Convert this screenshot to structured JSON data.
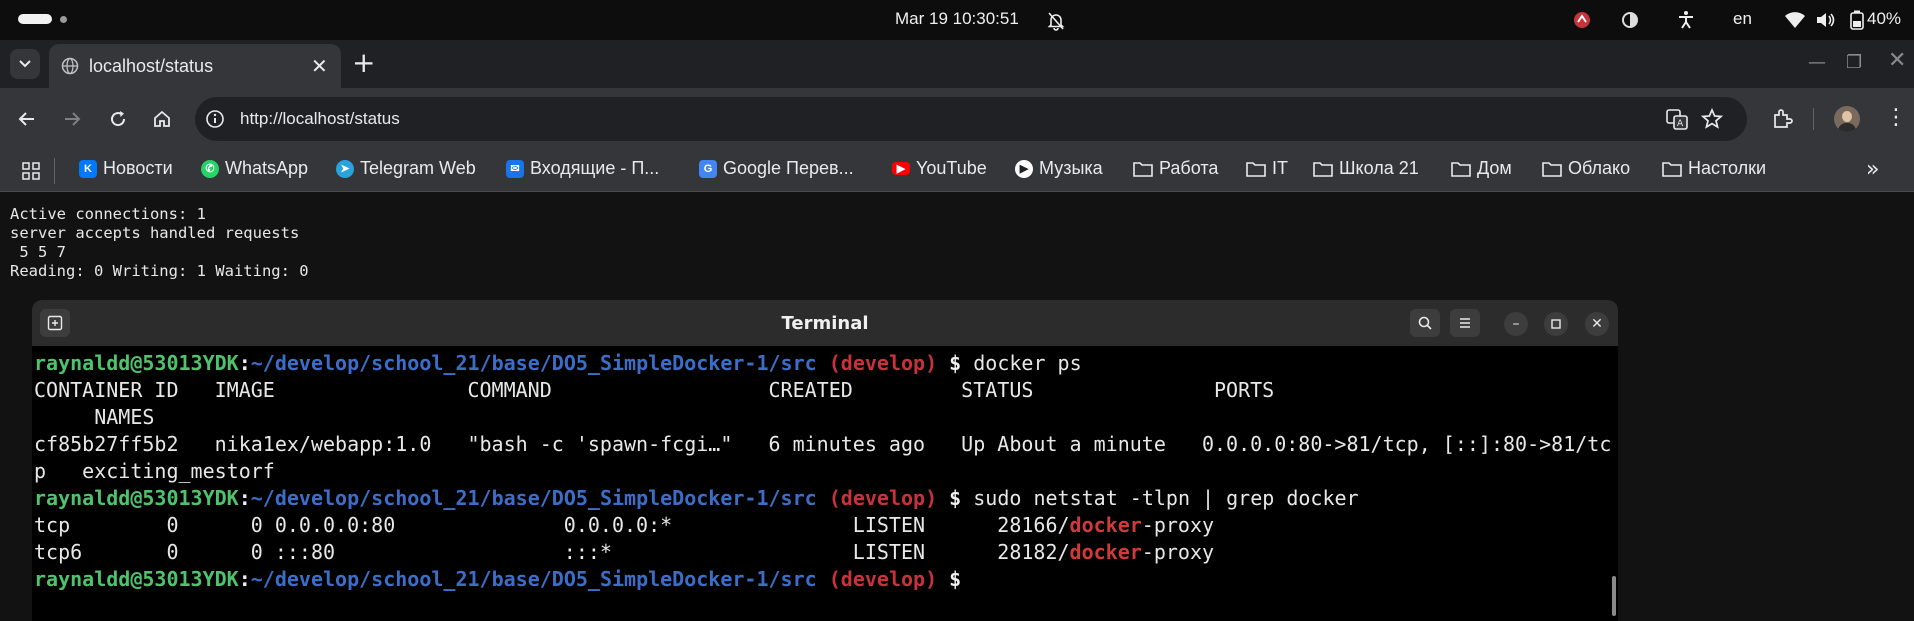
{
  "system": {
    "clock": "Mar 19  10:30:51",
    "language": "en",
    "battery": "40%"
  },
  "browser": {
    "tab_title": "localhost/status",
    "url": "http://localhost/status",
    "bookmarks": [
      {
        "label": "Новости",
        "icon": "vk-icon",
        "color": "#0077ff"
      },
      {
        "label": "WhatsApp",
        "icon": "whatsapp-icon",
        "color": "#25d366"
      },
      {
        "label": "Telegram Web",
        "icon": "telegram-icon",
        "color": "#2aa3dd"
      },
      {
        "label": "Входящие - П...",
        "icon": "mail-icon",
        "color": "#1a73e8"
      },
      {
        "label": "Google Перев...",
        "icon": "translate-icon",
        "color": "#4285f4"
      },
      {
        "label": "YouTube",
        "icon": "youtube-icon",
        "color": "#ff0000"
      },
      {
        "label": "Музыка",
        "icon": "music-icon",
        "color": "#ffffff"
      },
      {
        "label": "Работа",
        "icon": "folder-icon"
      },
      {
        "label": "IT",
        "icon": "folder-icon"
      },
      {
        "label": "Школа 21",
        "icon": "folder-icon"
      },
      {
        "label": "Дом",
        "icon": "folder-icon"
      },
      {
        "label": "Облако",
        "icon": "folder-icon"
      },
      {
        "label": "Настолки",
        "icon": "folder-icon"
      }
    ]
  },
  "page": {
    "line1": "Active connections: 1",
    "line2": "server accepts handled requests",
    "line3": " 5 5 7",
    "line4": "Reading: 0 Writing: 1 Waiting: 0"
  },
  "terminal": {
    "title": "Terminal",
    "prompt": {
      "user": "raynaldd@53013YDK",
      "path": "~/develop/school_21/base/DO5_SimpleDocker-1/src",
      "branch": "(develop)",
      "dollar": "$"
    },
    "cmd1": "docker ps",
    "ps_header": "CONTAINER ID   IMAGE                COMMAND                  CREATED         STATUS               PORTS",
    "ps_header2": "     NAMES",
    "ps_row": "cf85b27ff5b2   nika1ex/webapp:1.0   \"bash -c 'spawn-fcgi…\"   6 minutes ago   Up About a minute   0.0.0.0:80->81/tcp, [::]:80->81/tc",
    "ps_row2": "p   exciting_mestorf",
    "cmd2": "sudo netstat -tlpn | grep docker",
    "netstat": [
      {
        "pre": "tcp        0      0 0.0.0.0:80              0.0.0.0:*               LISTEN      28166/",
        "match": "docker",
        "post": "-proxy"
      },
      {
        "pre": "tcp6       0      0 :::80                   :::*                    LISTEN      28182/",
        "match": "docker",
        "post": "-proxy"
      }
    ]
  }
}
